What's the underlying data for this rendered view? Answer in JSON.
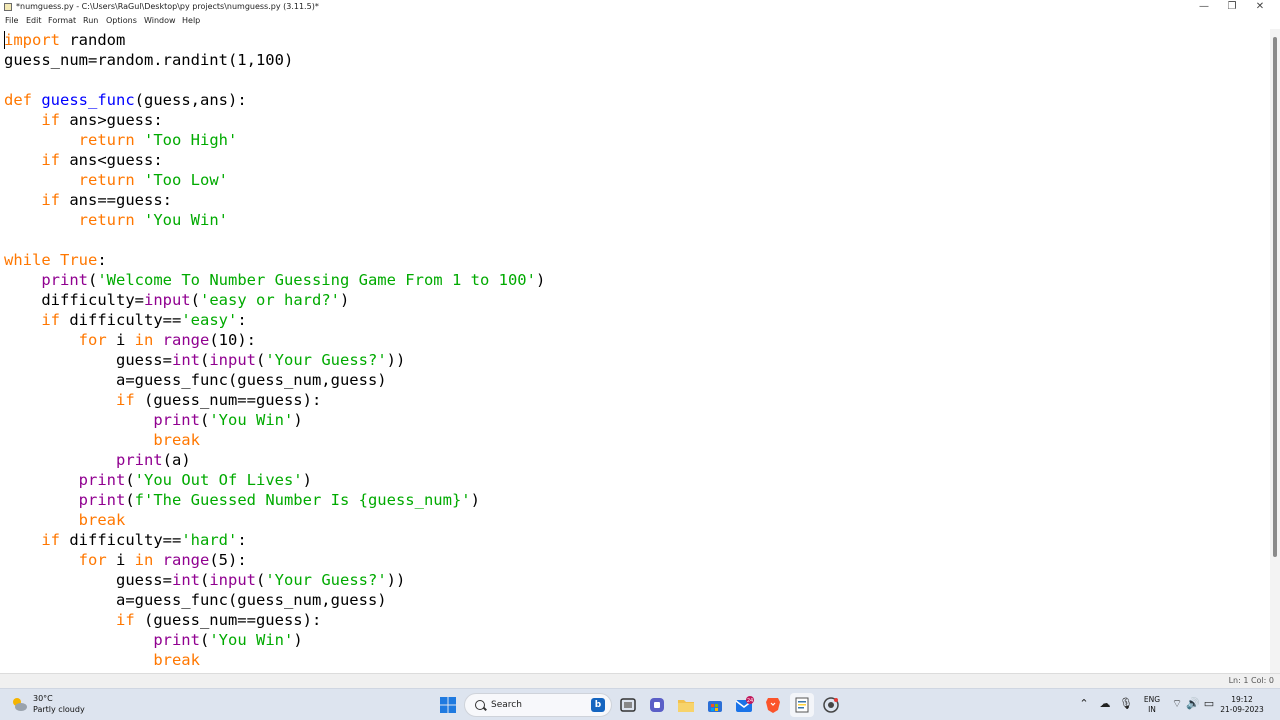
{
  "window": {
    "title": "*numguess.py - C:\\Users\\RaGul\\Desktop\\py projects\\numguess.py (3.11.5)*",
    "controls": [
      "—",
      "❐",
      "✕"
    ]
  },
  "menu": [
    "File",
    "Edit",
    "Format",
    "Run",
    "Options",
    "Window",
    "Help"
  ],
  "colors": {
    "keyword": "#ff7700",
    "builtin": "#900090",
    "string": "#00aa00",
    "definition": "#0000ff",
    "plain": "#000000"
  },
  "code": [
    [
      {
        "t": "import",
        "c": "keyword"
      },
      {
        "t": " random",
        "c": "plain"
      }
    ],
    [
      {
        "t": "guess_num=random.randint(1,100)",
        "c": "plain"
      }
    ],
    [],
    [
      {
        "t": "def",
        "c": "keyword"
      },
      {
        "t": " ",
        "c": "plain"
      },
      {
        "t": "guess_func",
        "c": "definition"
      },
      {
        "t": "(guess,ans):",
        "c": "plain"
      }
    ],
    [
      {
        "t": "    ",
        "c": "plain"
      },
      {
        "t": "if",
        "c": "keyword"
      },
      {
        "t": " ans>guess:",
        "c": "plain"
      }
    ],
    [
      {
        "t": "        ",
        "c": "plain"
      },
      {
        "t": "return",
        "c": "keyword"
      },
      {
        "t": " ",
        "c": "plain"
      },
      {
        "t": "'Too High'",
        "c": "string"
      }
    ],
    [
      {
        "t": "    ",
        "c": "plain"
      },
      {
        "t": "if",
        "c": "keyword"
      },
      {
        "t": " ans<guess:",
        "c": "plain"
      }
    ],
    [
      {
        "t": "        ",
        "c": "plain"
      },
      {
        "t": "return",
        "c": "keyword"
      },
      {
        "t": " ",
        "c": "plain"
      },
      {
        "t": "'Too Low'",
        "c": "string"
      }
    ],
    [
      {
        "t": "    ",
        "c": "plain"
      },
      {
        "t": "if",
        "c": "keyword"
      },
      {
        "t": " ans==guess:",
        "c": "plain"
      }
    ],
    [
      {
        "t": "        ",
        "c": "plain"
      },
      {
        "t": "return",
        "c": "keyword"
      },
      {
        "t": " ",
        "c": "plain"
      },
      {
        "t": "'You Win'",
        "c": "string"
      }
    ],
    [],
    [
      {
        "t": "while",
        "c": "keyword"
      },
      {
        "t": " ",
        "c": "plain"
      },
      {
        "t": "True",
        "c": "keyword"
      },
      {
        "t": ":",
        "c": "plain"
      }
    ],
    [
      {
        "t": "    ",
        "c": "plain"
      },
      {
        "t": "print",
        "c": "builtin"
      },
      {
        "t": "(",
        "c": "plain"
      },
      {
        "t": "'Welcome To Number Guessing Game From 1 to 100'",
        "c": "string"
      },
      {
        "t": ")",
        "c": "plain"
      }
    ],
    [
      {
        "t": "    difficulty=",
        "c": "plain"
      },
      {
        "t": "input",
        "c": "builtin"
      },
      {
        "t": "(",
        "c": "plain"
      },
      {
        "t": "'easy or hard?'",
        "c": "string"
      },
      {
        "t": ")",
        "c": "plain"
      }
    ],
    [
      {
        "t": "    ",
        "c": "plain"
      },
      {
        "t": "if",
        "c": "keyword"
      },
      {
        "t": " difficulty==",
        "c": "plain"
      },
      {
        "t": "'easy'",
        "c": "string"
      },
      {
        "t": ":",
        "c": "plain"
      }
    ],
    [
      {
        "t": "        ",
        "c": "plain"
      },
      {
        "t": "for",
        "c": "keyword"
      },
      {
        "t": " i ",
        "c": "plain"
      },
      {
        "t": "in",
        "c": "keyword"
      },
      {
        "t": " ",
        "c": "plain"
      },
      {
        "t": "range",
        "c": "builtin"
      },
      {
        "t": "(10):",
        "c": "plain"
      }
    ],
    [
      {
        "t": "            guess=",
        "c": "plain"
      },
      {
        "t": "int",
        "c": "builtin"
      },
      {
        "t": "(",
        "c": "plain"
      },
      {
        "t": "input",
        "c": "builtin"
      },
      {
        "t": "(",
        "c": "plain"
      },
      {
        "t": "'Your Guess?'",
        "c": "string"
      },
      {
        "t": "))",
        "c": "plain"
      }
    ],
    [
      {
        "t": "            a=guess_func(guess_num,guess)",
        "c": "plain"
      }
    ],
    [
      {
        "t": "            ",
        "c": "plain"
      },
      {
        "t": "if",
        "c": "keyword"
      },
      {
        "t": " (guess_num==guess):",
        "c": "plain"
      }
    ],
    [
      {
        "t": "                ",
        "c": "plain"
      },
      {
        "t": "print",
        "c": "builtin"
      },
      {
        "t": "(",
        "c": "plain"
      },
      {
        "t": "'You Win'",
        "c": "string"
      },
      {
        "t": ")",
        "c": "plain"
      }
    ],
    [
      {
        "t": "                ",
        "c": "plain"
      },
      {
        "t": "break",
        "c": "keyword"
      }
    ],
    [
      {
        "t": "            ",
        "c": "plain"
      },
      {
        "t": "print",
        "c": "builtin"
      },
      {
        "t": "(a)",
        "c": "plain"
      }
    ],
    [
      {
        "t": "        ",
        "c": "plain"
      },
      {
        "t": "print",
        "c": "builtin"
      },
      {
        "t": "(",
        "c": "plain"
      },
      {
        "t": "'You Out Of Lives'",
        "c": "string"
      },
      {
        "t": ")",
        "c": "plain"
      }
    ],
    [
      {
        "t": "        ",
        "c": "plain"
      },
      {
        "t": "print",
        "c": "builtin"
      },
      {
        "t": "(",
        "c": "plain"
      },
      {
        "t": "f'The Guessed Number Is {guess_num}'",
        "c": "string"
      },
      {
        "t": ")",
        "c": "plain"
      }
    ],
    [
      {
        "t": "        ",
        "c": "plain"
      },
      {
        "t": "break",
        "c": "keyword"
      }
    ],
    [
      {
        "t": "    ",
        "c": "plain"
      },
      {
        "t": "if",
        "c": "keyword"
      },
      {
        "t": " difficulty==",
        "c": "plain"
      },
      {
        "t": "'hard'",
        "c": "string"
      },
      {
        "t": ":",
        "c": "plain"
      }
    ],
    [
      {
        "t": "        ",
        "c": "plain"
      },
      {
        "t": "for",
        "c": "keyword"
      },
      {
        "t": " i ",
        "c": "plain"
      },
      {
        "t": "in",
        "c": "keyword"
      },
      {
        "t": " ",
        "c": "plain"
      },
      {
        "t": "range",
        "c": "builtin"
      },
      {
        "t": "(5):",
        "c": "plain"
      }
    ],
    [
      {
        "t": "            guess=",
        "c": "plain"
      },
      {
        "t": "int",
        "c": "builtin"
      },
      {
        "t": "(",
        "c": "plain"
      },
      {
        "t": "input",
        "c": "builtin"
      },
      {
        "t": "(",
        "c": "plain"
      },
      {
        "t": "'Your Guess?'",
        "c": "string"
      },
      {
        "t": "))",
        "c": "plain"
      }
    ],
    [
      {
        "t": "            a=guess_func(guess_num,guess)",
        "c": "plain"
      }
    ],
    [
      {
        "t": "            ",
        "c": "plain"
      },
      {
        "t": "if",
        "c": "keyword"
      },
      {
        "t": " (guess_num==guess):",
        "c": "plain"
      }
    ],
    [
      {
        "t": "                ",
        "c": "plain"
      },
      {
        "t": "print",
        "c": "builtin"
      },
      {
        "t": "(",
        "c": "plain"
      },
      {
        "t": "'You Win'",
        "c": "string"
      },
      {
        "t": ")",
        "c": "plain"
      }
    ],
    [
      {
        "t": "                ",
        "c": "plain"
      },
      {
        "t": "break",
        "c": "keyword"
      }
    ]
  ],
  "status": {
    "position": "Ln: 1   Col: 0"
  },
  "taskbar": {
    "weather_temp": "30°C",
    "weather_desc": "Partly cloudy",
    "search_label": "Search",
    "search_badge": "b",
    "mail_badge": "24",
    "apps": [
      "start-icon",
      "search",
      "task-view-icon",
      "teams-icon",
      "file-explorer-icon",
      "store-icon",
      "mail-icon",
      "brave-icon",
      "idle-editor-icon",
      "chrome-icon"
    ],
    "tray": {
      "lang_line1": "ENG",
      "lang_line2": "IN",
      "time": "19:12",
      "date": "21-09-2023"
    }
  }
}
